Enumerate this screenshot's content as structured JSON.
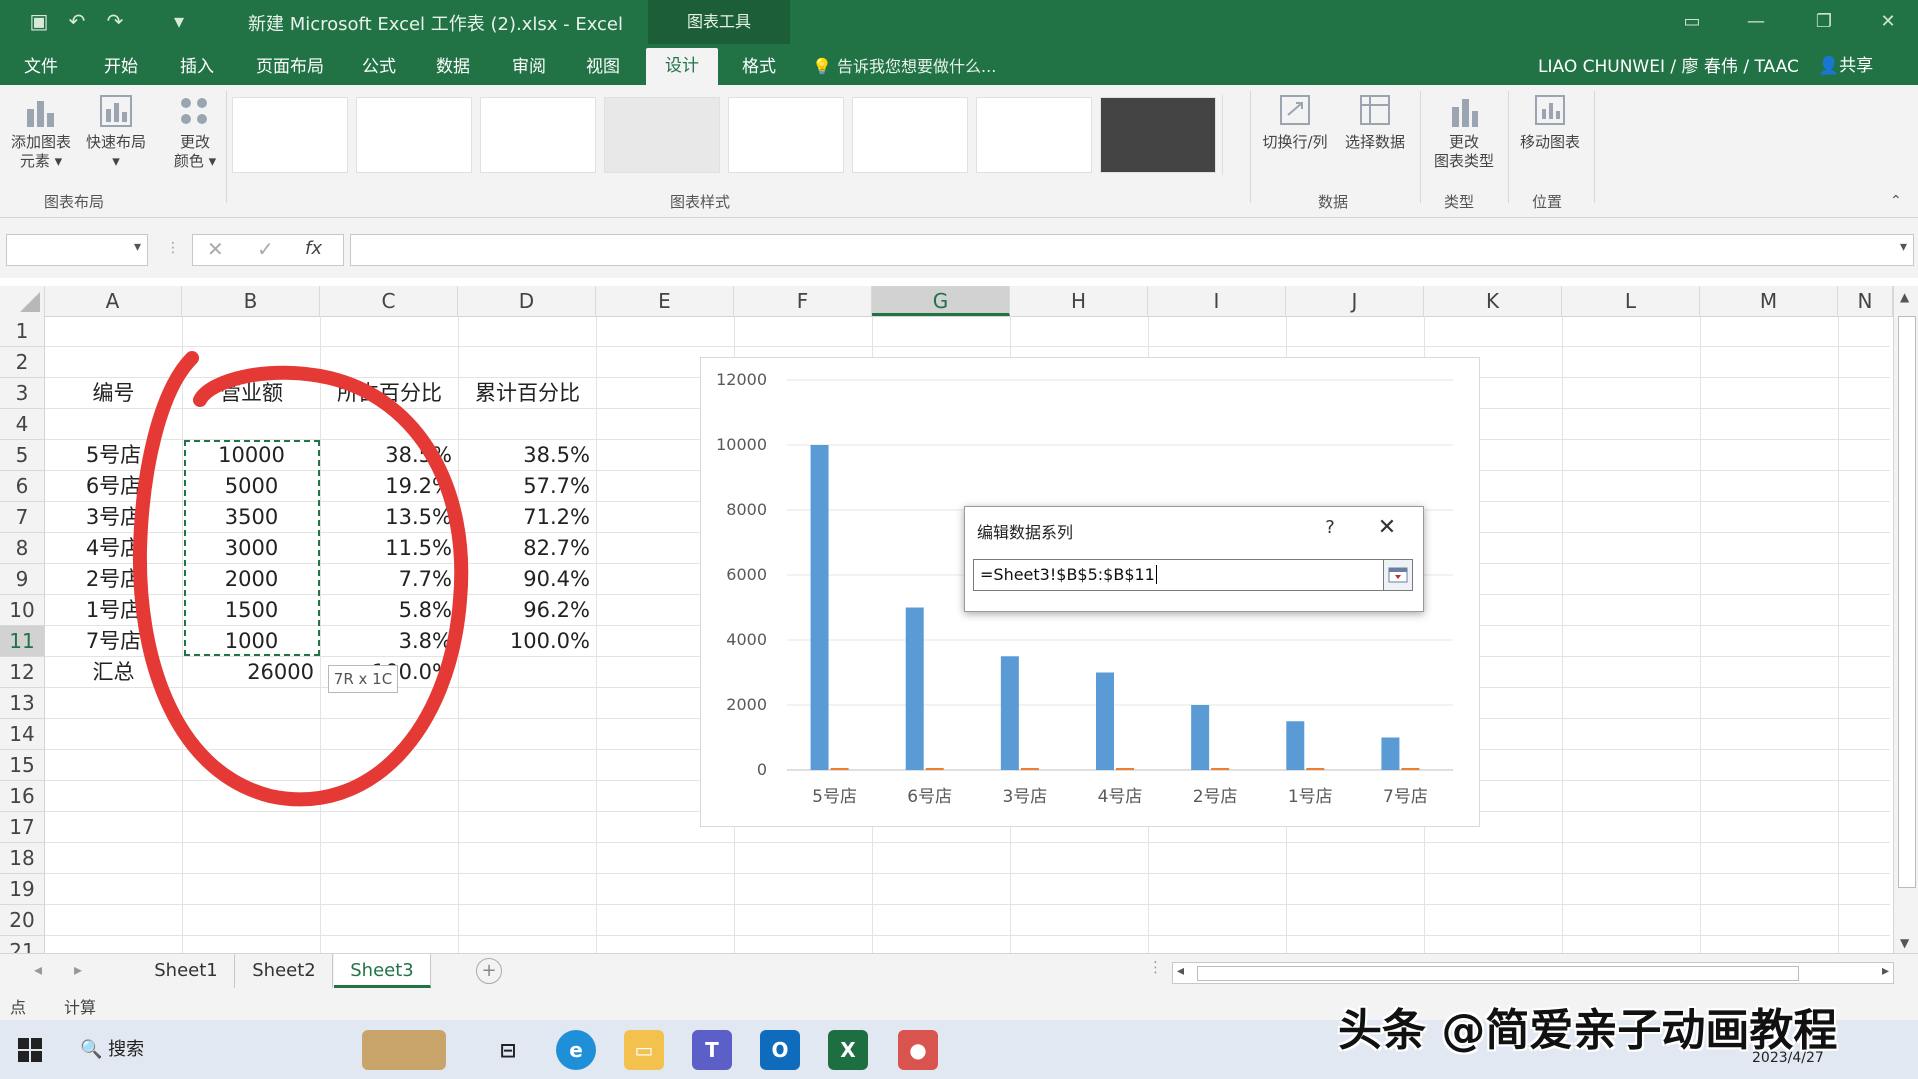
{
  "window": {
    "title": "新建 Microsoft Excel 工作表 (2).xlsx - Excel",
    "context_tab": "图表工具"
  },
  "ribbon_tabs": [
    {
      "label": "文件"
    },
    {
      "label": "开始"
    },
    {
      "label": "插入"
    },
    {
      "label": "页面布局"
    },
    {
      "label": "公式"
    },
    {
      "label": "数据"
    },
    {
      "label": "审阅"
    },
    {
      "label": "视图"
    },
    {
      "label": "设计",
      "active": true
    },
    {
      "label": "格式"
    }
  ],
  "tell_me": "告诉我您想要做什么...",
  "user": "LIAO CHUNWEI / 廖 春伟 / TAAC",
  "share": "共享",
  "ribbon": {
    "add_chart_element": "添加图表元素",
    "add_chart_element_l1": "添加图表",
    "add_chart_element_l2": "元素",
    "quick_layout": "快速布局",
    "change_colors_l1": "更改",
    "change_colors_l2": "颜色",
    "group_chart_layout": "图表布局",
    "group_chart_styles": "图表样式",
    "switch_row_col": "切换行/列",
    "select_data": "选择数据",
    "group_data": "数据",
    "change_type_l1": "更改",
    "change_type_l2": "图表类型",
    "group_type": "类型",
    "move_chart": "移动图表",
    "group_location": "位置"
  },
  "columns": [
    "A",
    "B",
    "C",
    "D",
    "E",
    "F",
    "G",
    "H",
    "I",
    "J",
    "K",
    "L",
    "M",
    "N"
  ],
  "selected_column": "G",
  "rows": [
    "1",
    "2",
    "3",
    "4",
    "5",
    "6",
    "7",
    "8",
    "9",
    "10",
    "11",
    "12",
    "13",
    "14",
    "15",
    "16",
    "17",
    "18",
    "19",
    "20",
    "21"
  ],
  "selected_row": "11",
  "sheet": {
    "headers": {
      "A": "编号",
      "B": "营业额",
      "C": "所占百分比",
      "D": "累计百分比"
    },
    "data": [
      {
        "A": "5号店",
        "B": "10000",
        "C": "38.5%",
        "D": "38.5%"
      },
      {
        "A": "6号店",
        "B": "5000",
        "C": "19.2%",
        "D": "57.7%"
      },
      {
        "A": "3号店",
        "B": "3500",
        "C": "13.5%",
        "D": "71.2%"
      },
      {
        "A": "4号店",
        "B": "3000",
        "C": "11.5%",
        "D": "82.7%"
      },
      {
        "A": "2号店",
        "B": "2000",
        "C": "7.7%",
        "D": "90.4%"
      },
      {
        "A": "1号店",
        "B": "1500",
        "C": "5.8%",
        "D": "96.2%"
      },
      {
        "A": "7号店",
        "B": "1000",
        "C": "3.8%",
        "D": "100.0%"
      }
    ],
    "total": {
      "A": "汇总",
      "B": "26000",
      "C": "100.0%"
    }
  },
  "selection_tooltip": "7R x 1C",
  "chart_data": {
    "type": "bar",
    "categories": [
      "5号店",
      "6号店",
      "3号店",
      "4号店",
      "2号店",
      "1号店",
      "7号店"
    ],
    "series": [
      {
        "values": [
          10000,
          5000,
          3500,
          3000,
          2000,
          1500,
          1000
        ],
        "color": "#5b9bd5"
      },
      {
        "values": [
          0.385,
          0.577,
          0.712,
          0.827,
          0.904,
          0.962,
          1.0
        ],
        "color": "#ed7d31"
      }
    ],
    "yticks": [
      "0",
      "2000",
      "4000",
      "6000",
      "8000",
      "10000",
      "12000"
    ],
    "ylim": [
      0,
      12000
    ],
    "grid": true,
    "title": "",
    "xlabel": "",
    "ylabel": ""
  },
  "dialog": {
    "title": "编辑数据系列",
    "help": "?",
    "close": "✕",
    "series_values": "=Sheet3!$B$5:$B$11"
  },
  "sheet_tabs": [
    {
      "label": "Sheet1"
    },
    {
      "label": "Sheet2"
    },
    {
      "label": "Sheet3",
      "active": true
    }
  ],
  "status": {
    "mode_left": "点",
    "mode": "计算"
  },
  "taskbar": {
    "search": "搜索",
    "date": "2023/4/27"
  },
  "watermark": "头条 @简爱亲子动画教程"
}
